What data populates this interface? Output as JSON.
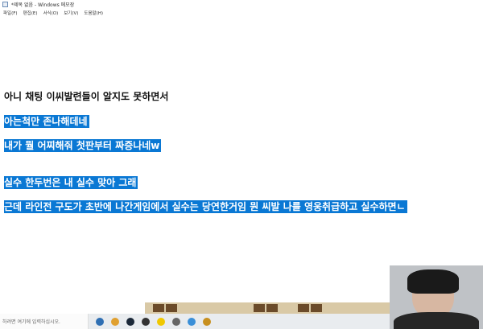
{
  "window": {
    "title": "*제목 없음 - Windows 메모장"
  },
  "menu": [
    "파일(F)",
    "편집(E)",
    "서식(O)",
    "보기(V)",
    "도움말(H)"
  ],
  "lines": [
    {
      "text": "아니 채팅 이씨발련들이 알지도 못하면서",
      "selected": false
    },
    {
      "text": "아는척만 존나해데네",
      "selected": true
    },
    {
      "text": "내가 뭘 어찌해줘 첫판부터 짜증나네w",
      "selected": true
    },
    {
      "text": "실수 한두번은 내 실수 맞아 그래",
      "selected": true
    },
    {
      "text": "근데 라인전 구도가 초반에 나간게임에서 실수는 당연한거임 뭔 씨발 나를 영웅취급하고 실수하면ㄴ",
      "selected": true
    }
  ],
  "taskbar": {
    "search_placeholder": "하려면 여기에 입력하십시오."
  },
  "colors": {
    "selection": "#0a78d4",
    "taskbar": "#e9ecef"
  }
}
